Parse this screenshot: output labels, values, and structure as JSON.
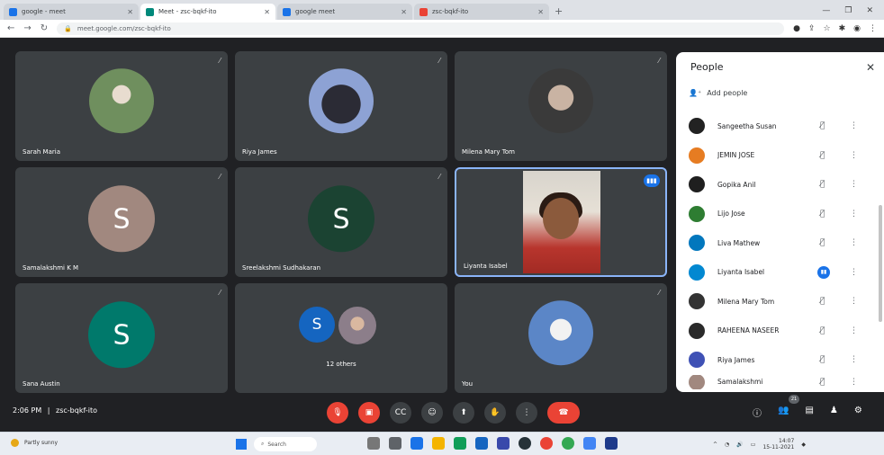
{
  "browser": {
    "tabs": [
      {
        "label": "google - meet",
        "active": false,
        "color": "#1a73e8"
      },
      {
        "label": "Meet - zsc-bqkf-ito",
        "active": true,
        "color": "#00897b"
      },
      {
        "label": "google meet",
        "active": false,
        "color": "#1a73e8"
      },
      {
        "label": "zsc-bqkf-ito",
        "active": false,
        "color": "#ea4335"
      }
    ],
    "url": "meet.google.com/zsc-bqkf-ito"
  },
  "tiles": [
    {
      "name": "Sarah Maria",
      "type": "photo",
      "photo_color": "#7a9b6a"
    },
    {
      "name": "Riya James",
      "type": "photo",
      "photo_color": "#7b8fc1"
    },
    {
      "name": "Milena Mary Tom",
      "type": "photo",
      "photo_color": "#4a4a4a"
    },
    {
      "name": "Samalakshmi K M",
      "type": "letter",
      "letter": "S",
      "color": "#a1887f"
    },
    {
      "name": "Sreelakshmi Sudhakaran",
      "type": "letter",
      "letter": "S",
      "color": "#1b4332"
    },
    {
      "name": "Liyanta Isabel",
      "type": "video"
    },
    {
      "name": "Sana Austin",
      "type": "letter",
      "letter": "S",
      "color": "#00796b"
    },
    {
      "name": "12 others",
      "type": "others",
      "letter": "S",
      "color": "#1565c0"
    },
    {
      "name": "You",
      "type": "photo",
      "photo_color": "#5b86c7"
    }
  ],
  "panel": {
    "title": "People",
    "add_people": "Add people",
    "people": [
      {
        "name": "Sangeetha Susan",
        "color": "#222222",
        "speaking": false
      },
      {
        "name": "JEMIN JOSE",
        "color": "#e67c22",
        "speaking": false
      },
      {
        "name": "Gopika Anil",
        "color": "#1f1f1f",
        "speaking": false
      },
      {
        "name": "Lijo Jose",
        "color": "#2e7d32",
        "speaking": false
      },
      {
        "name": "Liva Mathew",
        "color": "#0277bd",
        "speaking": false
      },
      {
        "name": "Liyanta Isabel",
        "color": "#0288d1",
        "speaking": true
      },
      {
        "name": "Milena Mary Tom",
        "color": "#333333",
        "speaking": false
      },
      {
        "name": "RAHEENA NASEER",
        "color": "#2a2a2a",
        "speaking": false
      },
      {
        "name": "Riya James",
        "color": "#3f51b5",
        "speaking": false
      },
      {
        "name": "Samalakshmi",
        "color": "#a1887f",
        "speaking": false
      }
    ]
  },
  "bottom": {
    "time": "2:06 PM",
    "meeting_code": "zsc-bqkf-ito",
    "participant_count": "21"
  },
  "taskbar": {
    "weather": "Partly sunny",
    "search": "Search",
    "date": "15-11-2021",
    "clock": "14:07"
  }
}
